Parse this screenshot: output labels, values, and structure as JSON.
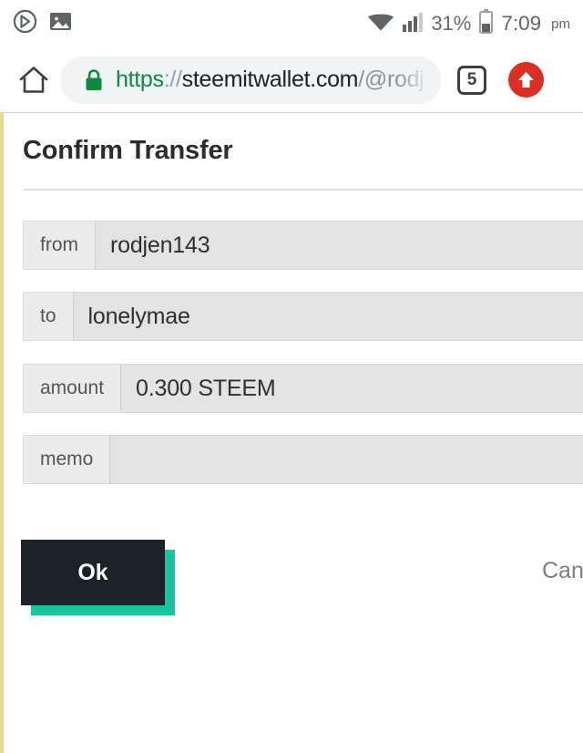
{
  "status_bar": {
    "left_icons": [
      {
        "name": "circled-arrow-icon",
        "glyph": "play-circle"
      },
      {
        "name": "image-notification-icon",
        "glyph": "picture"
      }
    ],
    "wifi_icon": "wifi-icon",
    "signal_icon": "cellular-signal-icon",
    "battery_percent": "31%",
    "battery_icon": "battery-icon",
    "time": "7:09",
    "am_pm": "pm"
  },
  "browser": {
    "home_icon": "home-icon",
    "lock_icon": "lock-icon",
    "url": {
      "scheme": "https",
      "separator": "://",
      "host": "steemitwallet.com",
      "path": "/@rodj"
    },
    "url_full": "https://steemitwallet.com/@rodj",
    "tab_count": "5",
    "update_icon": "upload-arrow-icon"
  },
  "page": {
    "title": "Confirm Transfer",
    "accent_color": "#ecd98b",
    "rows": [
      {
        "label": "from",
        "value": "rodjen143"
      },
      {
        "label": "to",
        "value": "lonelymae"
      },
      {
        "label": "amount",
        "value": "0.300 STEEM"
      },
      {
        "label": "memo",
        "value": ""
      }
    ],
    "actions": {
      "ok_label": "Ok",
      "ok_bg": "#1b2229",
      "ok_shadow": "#19c5a0",
      "cancel_label": "Cancel"
    }
  }
}
